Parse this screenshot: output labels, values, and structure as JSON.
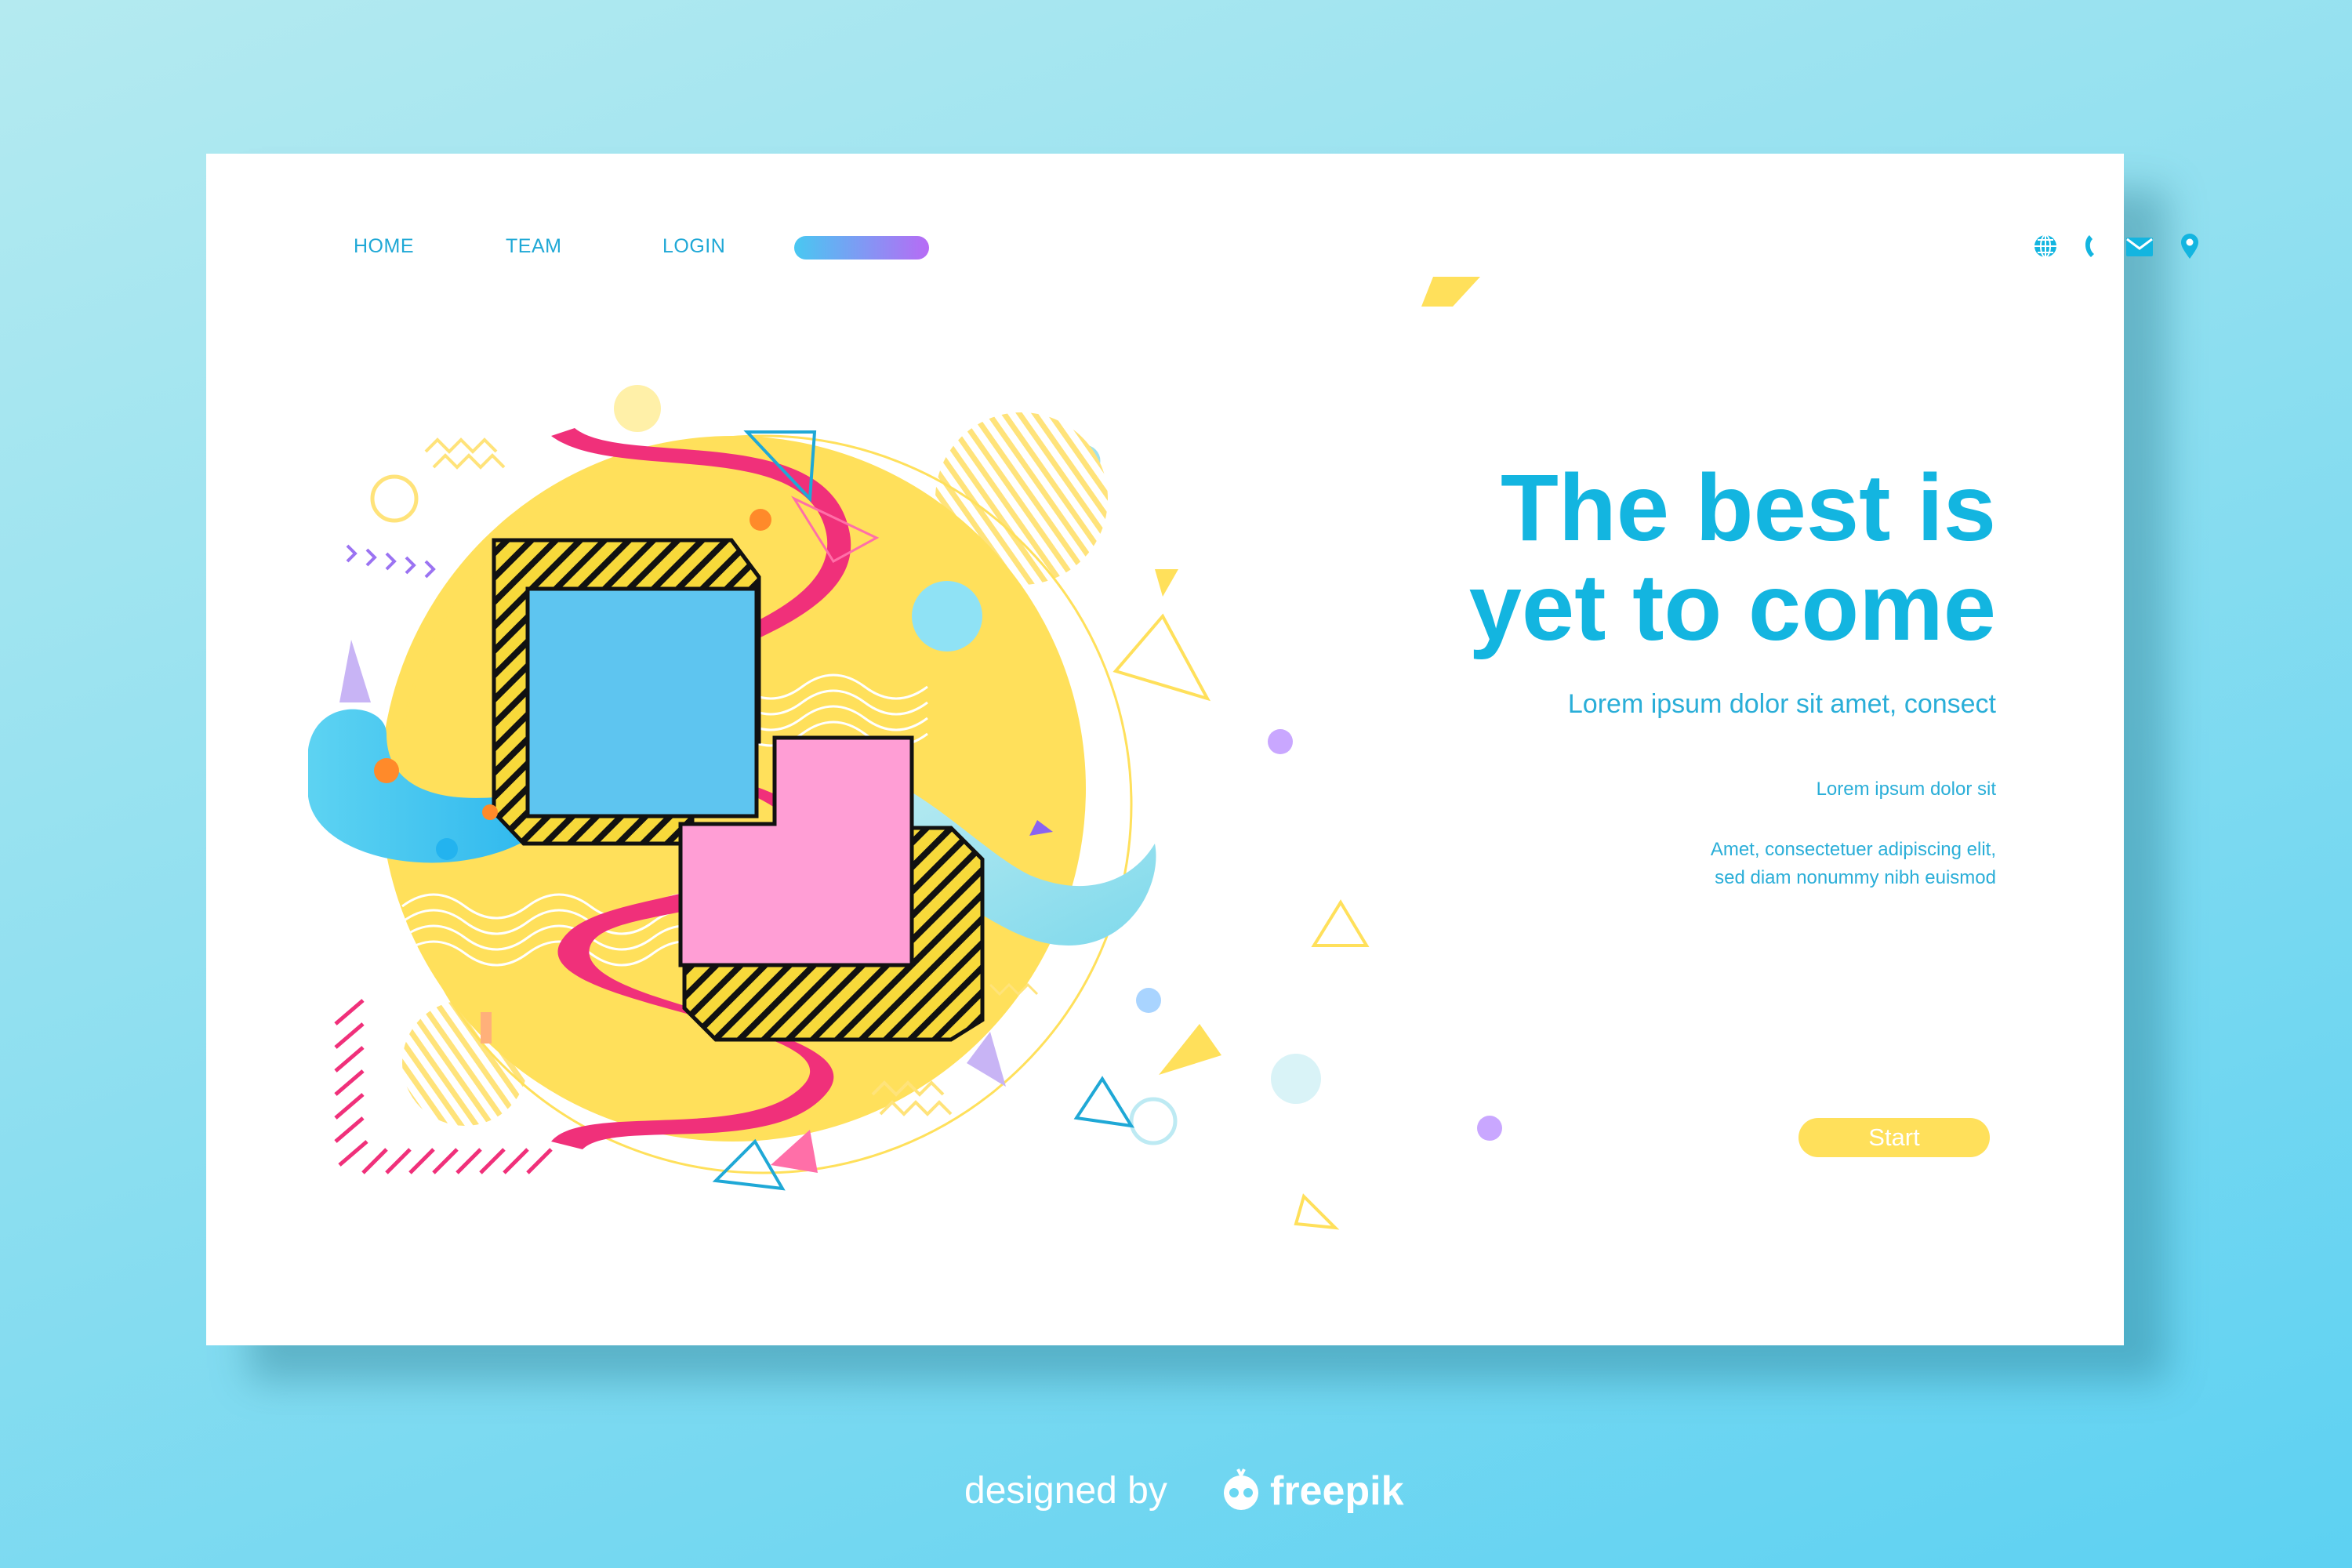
{
  "nav": {
    "items": [
      {
        "label": "HOME"
      },
      {
        "label": "TEAM"
      },
      {
        "label": "LOGIN"
      }
    ]
  },
  "contact_icons": [
    "globe-icon",
    "phone-icon",
    "mail-icon",
    "location-pin-icon"
  ],
  "hero": {
    "headline_line1": "The best is",
    "headline_line2": "yet to come",
    "subtitle": "Lorem ipsum dolor sit amet, consect",
    "small_text": "Lorem ipsum dolor sit",
    "body_line1": "Amet, consectetuer adipiscing elit,",
    "body_line2": "sed diam nonummy nibh euismod",
    "cta_label": "Start"
  },
  "credit": {
    "prefix": "designed by",
    "brand": "freepik"
  },
  "colors": {
    "accent": "#13b5e0",
    "button": "#ffe05b",
    "yellow_shape": "#ffe05b",
    "blue_square": "#5ec5f0",
    "pink_square": "#ff9ed5",
    "ribbon": "#f0307a"
  }
}
